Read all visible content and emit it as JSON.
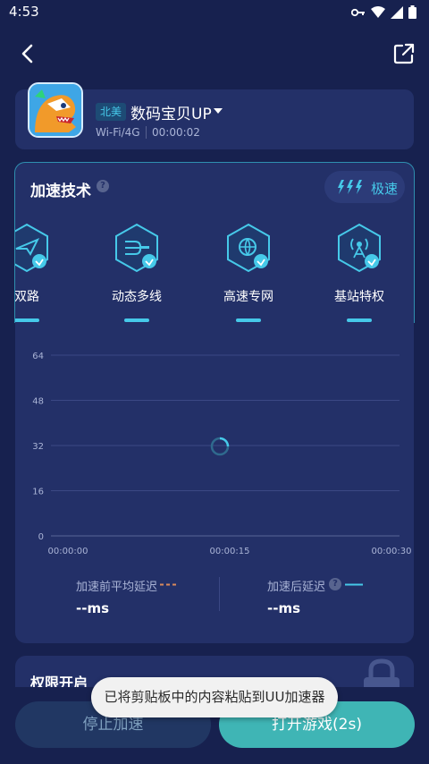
{
  "status_bar": {
    "time": "4:53",
    "icons": [
      "key-icon",
      "wifi-icon",
      "signal-icon",
      "battery-icon"
    ]
  },
  "nav": {
    "back_icon": "chevron-left-icon",
    "share_icon": "external-link-icon"
  },
  "game": {
    "region": "北美",
    "name": "数码宝贝UP",
    "network": "Wi-Fi/4G",
    "elapsed": "00:00:02"
  },
  "tech": {
    "title": "加速技术",
    "speed_label": "极速",
    "items": [
      {
        "label": "双路",
        "icon": "plane-hex-icon"
      },
      {
        "label": "动态多线",
        "icon": "multiline-hex-icon"
      },
      {
        "label": "高速专网",
        "icon": "globe-hex-icon"
      },
      {
        "label": "基站特权",
        "icon": "tower-hex-icon"
      }
    ]
  },
  "chart_data": {
    "type": "line",
    "title": "",
    "xlabel": "",
    "ylabel": "",
    "y_ticks": [
      64,
      48,
      32,
      16,
      0
    ],
    "x_ticks": [
      "00:00:00",
      "00:00:15",
      "00:00:30"
    ],
    "ylim": [
      0,
      64
    ],
    "grid": true,
    "series": [
      {
        "name": "加速前平均延迟",
        "values": [],
        "color": "#d98a5b",
        "style": "dashed"
      },
      {
        "name": "加速后延迟",
        "values": [],
        "color": "#46c9e9",
        "style": "solid"
      }
    ],
    "loading": true
  },
  "latency": {
    "before_label": "加速前平均延迟",
    "before_value": "--ms",
    "after_label": "加速后延迟",
    "after_value": "--ms"
  },
  "permissions": {
    "title": "权限开启"
  },
  "actions": {
    "stop_label": "停止加速",
    "open_label": "打开游戏(2s)"
  },
  "toast": {
    "text": "已将剪贴板中的内容粘贴到UU加速器"
  },
  "colors": {
    "background": "#17214f",
    "card": "#233068",
    "accent": "#46c9e9",
    "primary_button": "#3fb5b5"
  }
}
